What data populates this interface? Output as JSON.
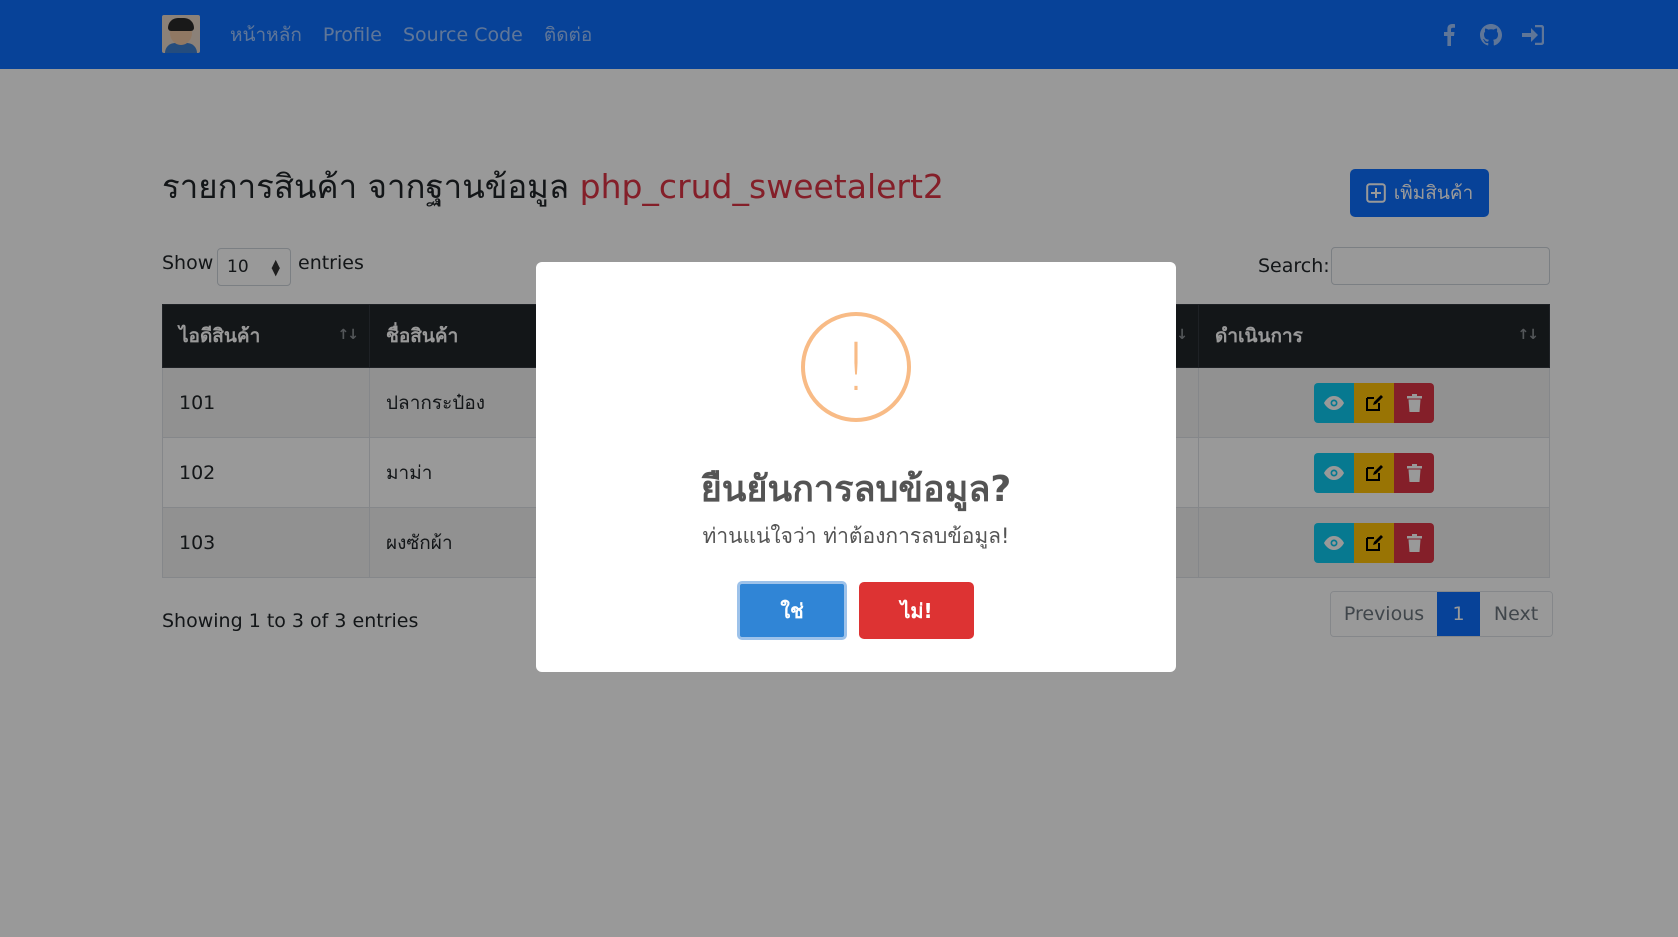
{
  "navbar": {
    "links": [
      "หน้าหลัก",
      "Profile",
      "Source Code",
      "ติดต่อ"
    ],
    "icons": [
      "facebook-icon",
      "github-icon",
      "sign-in-icon"
    ]
  },
  "header": {
    "title_prefix": "รายการสินค้า จากฐานข้อมูล",
    "title_db": "php_crud_sweetalert2",
    "add_button": "เพิ่มสินค้า"
  },
  "table_controls": {
    "show_label": "Show",
    "page_length": "10",
    "entries_label": "entries",
    "search_label": "Search:",
    "search_value": ""
  },
  "table": {
    "columns": [
      "ไอดีสินค้า",
      "ชื่อสินค้า",
      "ดำเนินการ"
    ],
    "rows": [
      {
        "id": "101",
        "name": "ปลากระป๋อง"
      },
      {
        "id": "102",
        "name": "มาม่า"
      },
      {
        "id": "103",
        "name": "ผงซักผ้า"
      }
    ]
  },
  "footer": {
    "info": "Showing 1 to 3 of 3 entries",
    "pagination": {
      "previous": "Previous",
      "current": "1",
      "next": "Next"
    }
  },
  "modal": {
    "icon": "!",
    "title": "ยืนยันการลบข้อมูล?",
    "text": "ท่านแน่ใจว่า ท่าต้องการลบข้อมูล!",
    "confirm": "ใช่",
    "cancel": "ไม่!"
  },
  "colors": {
    "navbar": "#0d6efd",
    "db_name": "#dc3545",
    "confirm": "#3085d6",
    "cancel": "#dd3333",
    "warning": "#f8bb86"
  }
}
